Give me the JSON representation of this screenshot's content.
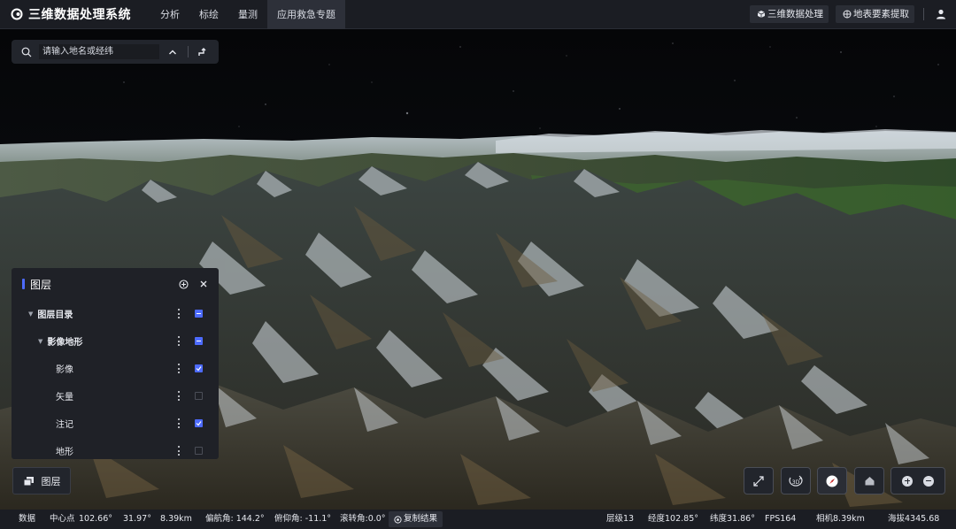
{
  "app": {
    "title": "三维数据处理系统"
  },
  "nav": {
    "items": [
      "分析",
      "标绘",
      "量测",
      "应用救急专题"
    ],
    "active_index": 3
  },
  "toolbar": {
    "process_3d": "三维数据处理",
    "feature_extract": "地表要素提取"
  },
  "search": {
    "placeholder": "请输入地名或经纬"
  },
  "layer_panel": {
    "title": "图层",
    "tree": [
      {
        "label": "图层目录",
        "level": 0,
        "caret": true,
        "bold": true,
        "state": "partial"
      },
      {
        "label": "影像地形",
        "level": 1,
        "caret": true,
        "bold": true,
        "state": "partial"
      },
      {
        "label": "影像",
        "level": 2,
        "caret": false,
        "bold": false,
        "state": "checked"
      },
      {
        "label": "矢量",
        "level": 2,
        "caret": false,
        "bold": false,
        "state": "unchecked"
      },
      {
        "label": "注记",
        "level": 2,
        "caret": false,
        "bold": false,
        "state": "checked"
      },
      {
        "label": "地形",
        "level": 2,
        "caret": false,
        "bold": false,
        "state": "unchecked"
      }
    ]
  },
  "layer_button": {
    "label": "图层"
  },
  "status": {
    "data_label": "数据",
    "center_label": "中心点",
    "lon": "102.66°",
    "lat": "31.97°",
    "distance": "8.39km",
    "heading": "偏航角: 144.2°",
    "pitch": "俯仰角: -11.1°",
    "roll": "滚转角:0.0°",
    "copy_label": "复制结果",
    "level": "层级13",
    "longitude": "经度102.85°",
    "latitude": "纬度31.86°",
    "fps": "FPS164",
    "camera": "相机8.39km",
    "altitude": "海拔4345.68"
  },
  "colors": {
    "accent": "#4d6bff",
    "panel_bg": "#1f2127",
    "bar_bg": "#1b1d23"
  }
}
